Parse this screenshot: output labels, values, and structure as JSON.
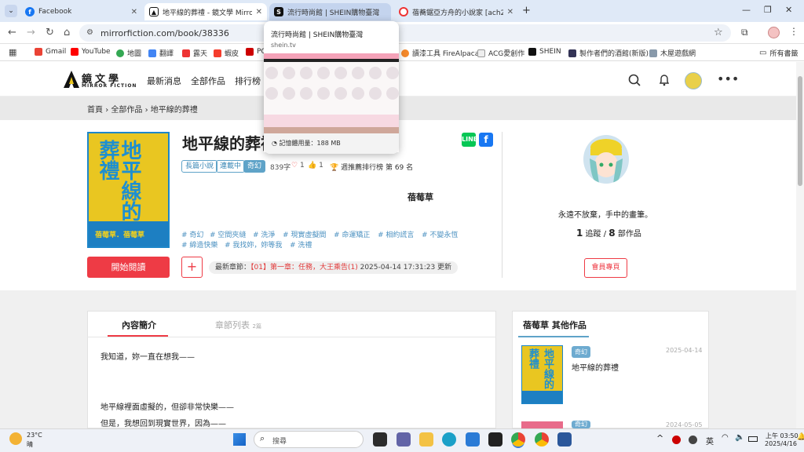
{
  "browser": {
    "tabs": [
      {
        "title": "Facebook",
        "favicon": "facebook-icon"
      },
      {
        "title": "地平線的葬禮 - 鏡文學 Mirror Fiction",
        "favicon": "mirror-fiction-icon"
      },
      {
        "title": "流行時尚館 | SHEIN購物臺灣",
        "favicon": "shein-icon"
      },
      {
        "title": "蓓蕎鋸亞方舟的小說家 [ach27...",
        "favicon": "site-icon"
      }
    ],
    "url": "mirrorfiction.com/book/38336",
    "bookmarks": [
      "Gmail",
      "YouTube",
      "地圖",
      "翻譯",
      "露天",
      "蝦皮",
      "PC",
      "讀漆工具 FireAlpaca",
      "ACG愛創作",
      "SHEIN",
      "製作者們的酒館(新版)",
      "木屋遊戲網"
    ],
    "all_bookmarks": "所有書籤",
    "tab_preview": {
      "title": "流行時尚館 | SHEIN購物臺灣",
      "domain": "shein.tv",
      "memory": "記憶體用量：188 MB"
    }
  },
  "site": {
    "logo_text": "鏡文學",
    "logo_sub": "MIRROR FICTION",
    "nav": [
      "最新消息",
      "全部作品",
      "排行榜"
    ],
    "breadcrumb": [
      "首頁",
      "全部作品",
      "地平線的葬禮"
    ]
  },
  "book": {
    "title": "地平線的葬禮",
    "cover_text": "地平線的葬禮",
    "cover_author": "蓓莓草．蓓莓草",
    "tags": [
      "長篇小說",
      "連載中",
      "奇幻"
    ],
    "word_count": "839字",
    "likes": "1",
    "thumbs": "1",
    "rank": "週推薦排行榜 第 69 名",
    "hashtags": [
      "# 奇幻",
      "# 空間夾縫",
      "# 洗淨",
      "# 現實虛擬間",
      "# 命運矯正",
      "# 相約謊言",
      "# 不變永恆",
      "# 締造快樂",
      "# 我找妳，妳等我",
      "# 洗禮"
    ],
    "read_button": "開始閱讀",
    "add_button": "+",
    "latest_label": "最新章節：",
    "latest_chapter": "【01】第一章：任務，大王乘告(1)",
    "latest_time": "2025-04-14 17:31:23 更新"
  },
  "author": {
    "name": "蓓莓草",
    "motto": "永遠不放棄，手中的畫筆。",
    "following": "1",
    "following_label": "追蹤 /",
    "works": "8",
    "works_label": "部作品",
    "member_button": "會員專頁"
  },
  "content": {
    "tab_intro": "內容簡介",
    "tab_chapters": "章節列表",
    "chapter_count": "2篇",
    "lines": [
      "我知道，妳一直在想我——",
      "地平線裡面虛擬的，但卻非常快樂——",
      "但是，我想回到現實世界，因為——"
    ]
  },
  "sidebar": {
    "title": "蓓莓草 其他作品",
    "works": [
      {
        "badge": "奇幻",
        "date": "2025-04-14",
        "title": "地平線的葬禮"
      },
      {
        "badge": "奇幻",
        "date": "2024-05-05",
        "title": ""
      }
    ]
  },
  "taskbar": {
    "weather_temp": "23°C",
    "weather_desc": "晴",
    "search": "搜尋",
    "ime": "英",
    "time": "上午 03:50",
    "date": "2025/4/16"
  },
  "colors": {
    "accent": "#ee3b45",
    "tag": "#5fa3c8",
    "cover_yellow": "#e9c621",
    "cover_blue": "#1d7fc2"
  }
}
